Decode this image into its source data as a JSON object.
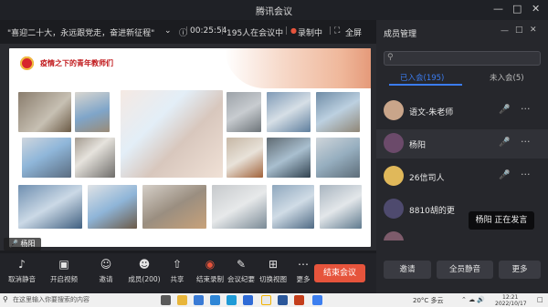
{
  "window": {
    "title": "腾讯会议",
    "controls": [
      "minimize-icon",
      "maximize-icon",
      "close-icon"
    ]
  },
  "topic_bar": {
    "topic": "\"喜迎二十大，永远跟党走，奋进新征程\"",
    "timer": "00:25:54",
    "participants_text": "195人在会议中",
    "recording": "录制中",
    "fullscreen": "全屏"
  },
  "slide": {
    "title": "疫情之下的青年教师们"
  },
  "speaker_chip": "杨阳",
  "toolbar": {
    "buttons": [
      {
        "icon": "mic-icon",
        "label": "取消静音"
      },
      {
        "icon": "camera-icon",
        "label": "开启视频"
      },
      {
        "icon": "invite-icon",
        "label": "邀请"
      },
      {
        "icon": "members-icon",
        "label": "成员(200)"
      },
      {
        "icon": "share-icon",
        "label": "共享"
      },
      {
        "icon": "record-icon",
        "label": "结束录制"
      },
      {
        "icon": "minutes-icon",
        "label": "会议纪要"
      },
      {
        "icon": "layout-icon",
        "label": "切换视图"
      },
      {
        "icon": "more-icon",
        "label": "更多"
      }
    ],
    "end_meeting": "结束会议"
  },
  "member_panel": {
    "title": "成员管理",
    "search_placeholder": "",
    "tabs": [
      "已入会(195)",
      "未入会(5)"
    ],
    "members": [
      {
        "name": "语文-朱老师",
        "avatar_color": "#c9a58a"
      },
      {
        "name": "杨阳",
        "avatar_color": "#6b4a6a"
      },
      {
        "name": "26信司人",
        "avatar_color": "#e0b85a"
      },
      {
        "name": "8810胡的更",
        "avatar_color": "#4e4a6e"
      }
    ],
    "speaking_tooltip": "杨阳  正在发言",
    "buttons": [
      "邀请",
      "全员静音",
      "更多"
    ]
  },
  "taskbar": {
    "search_text": "在这里输入你要搜索的内容",
    "weather": "20°C 多云",
    "time": "12:21",
    "date": "2022/10/17"
  }
}
